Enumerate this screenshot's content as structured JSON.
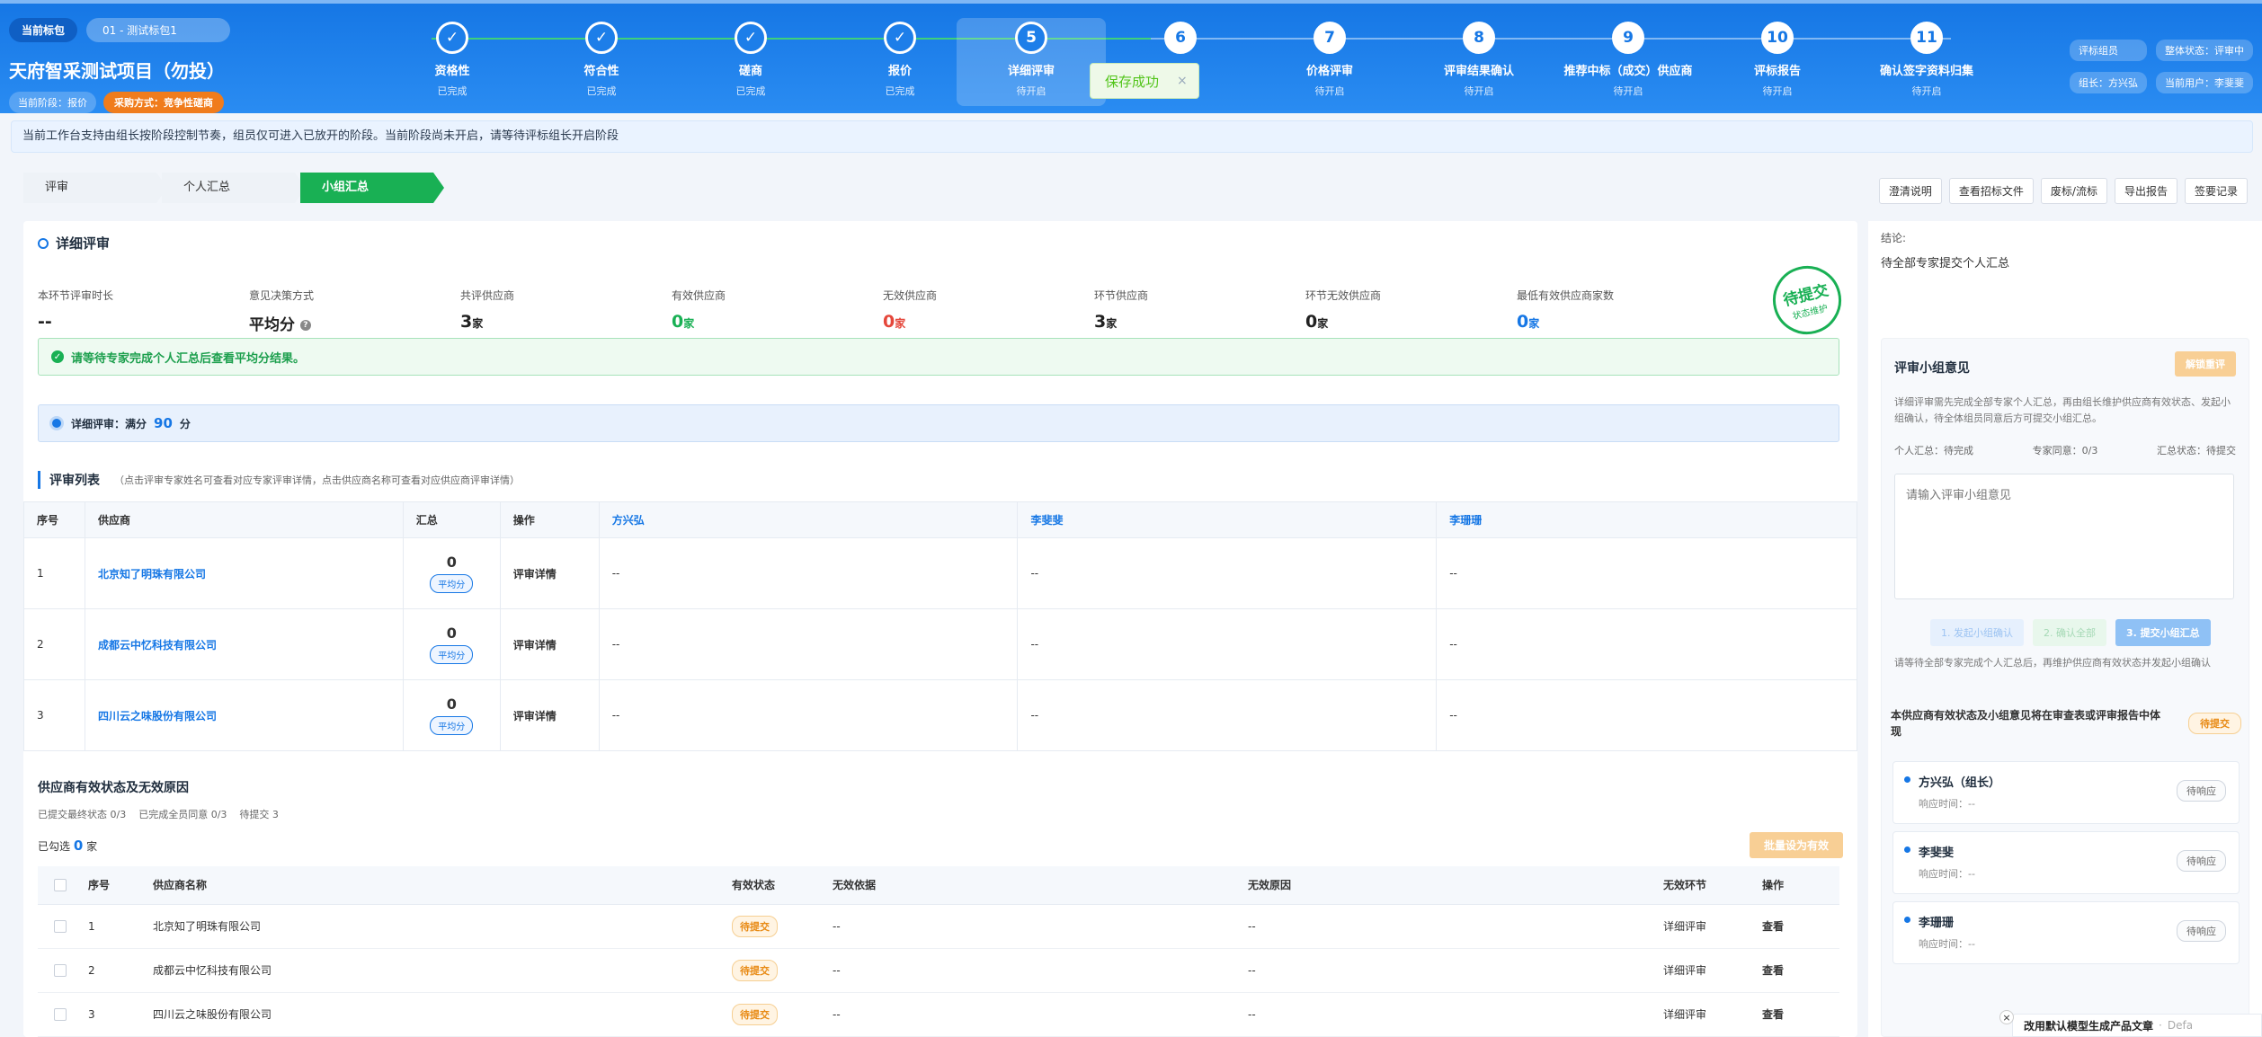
{
  "header": {
    "current_bid_label": "当前标包",
    "current_bid_value": "01 - 测试标包1",
    "project_title": "天府智采测试项目（勿投）",
    "current_stage": "当前阶段：报价",
    "procurement_method": "采购方式：竞争性磋商",
    "right_pills": [
      "评标组员",
      "整体状态：评审中",
      "组长：方兴弘",
      "当前用户：李斐斐"
    ]
  },
  "steps": [
    {
      "num": "✓",
      "name": "资格性",
      "status": "已完成",
      "state": "done"
    },
    {
      "num": "✓",
      "name": "符合性",
      "status": "已完成",
      "state": "done"
    },
    {
      "num": "✓",
      "name": "磋商",
      "status": "已完成",
      "state": "done"
    },
    {
      "num": "✓",
      "name": "报价",
      "status": "已完成",
      "state": "done"
    },
    {
      "num": "5",
      "name": "详细评审",
      "status": "待开启",
      "state": "active"
    },
    {
      "num": "6",
      "name": "",
      "status": "",
      "state": "todo"
    },
    {
      "num": "7",
      "name": "价格评审",
      "status": "待开启",
      "state": "todo"
    },
    {
      "num": "8",
      "name": "评审结果确认",
      "status": "待开启",
      "state": "todo"
    },
    {
      "num": "9",
      "name": "推荐中标（成交）供应商",
      "status": "待开启",
      "state": "todo"
    },
    {
      "num": "10",
      "name": "评标报告",
      "status": "待开启",
      "state": "todo"
    },
    {
      "num": "11",
      "name": "确认签字资料归集",
      "status": "待开启",
      "state": "todo"
    }
  ],
  "toast": {
    "text": "保存成功",
    "close": "×"
  },
  "notice": "当前工作台支持由组长按阶段控制节奏，组员仅可进入已放开的阶段。当前阶段尚未开启，请等待评标组长开启阶段",
  "tabs": [
    "评审",
    "个人汇总",
    "小组汇总"
  ],
  "top_actions": [
    "澄清说明",
    "查看招标文件",
    "废标/流标",
    "导出报告",
    "签要记录"
  ],
  "section": {
    "title": "详细评审",
    "metrics": [
      {
        "label": "本环节评审时长",
        "value": "--",
        "unit": "",
        "color": ""
      },
      {
        "label": "意见决策方式",
        "value": "平均分",
        "unit": "",
        "color": ""
      },
      {
        "label": "共评供应商",
        "value": "3",
        "unit": "家",
        "color": ""
      },
      {
        "label": "有效供应商",
        "value": "0",
        "unit": "家",
        "color": "green"
      },
      {
        "label": "无效供应商",
        "value": "0",
        "unit": "家",
        "color": "red"
      },
      {
        "label": "环节供应商",
        "value": "3",
        "unit": "家",
        "color": ""
      },
      {
        "label": "环节无效供应商",
        "value": "0",
        "unit": "家",
        "color": ""
      },
      {
        "label": "最低有效供应商家数",
        "value": "0",
        "unit": "家",
        "color": "blue"
      }
    ],
    "stamp_main": "待提交",
    "stamp_sub": "状态维护",
    "alert": "请等待专家完成个人汇总后查看平均分结果。",
    "score_prefix": "详细评审：满分",
    "score_value": "90",
    "score_unit": "分"
  },
  "list": {
    "title": "评审列表",
    "hint": "（点击评审专家姓名可查看对应专家评审详情，点击供应商名称可查看对应供应商评审详情）",
    "headers": [
      "序号",
      "供应商",
      "汇总",
      "操作",
      "方兴弘",
      "李斐斐",
      "李珊珊"
    ],
    "rows": [
      {
        "no": "1",
        "supplier": "北京知了明珠有限公司",
        "sum": "0",
        "tag": "平均分",
        "op": "评审详情",
        "e1": "--",
        "e2": "--",
        "e3": "--"
      },
      {
        "no": "2",
        "supplier": "成都云中忆科技有限公司",
        "sum": "0",
        "tag": "平均分",
        "op": "评审详情",
        "e1": "--",
        "e2": "--",
        "e3": "--"
      },
      {
        "no": "3",
        "supplier": "四川云之味股份有限公司",
        "sum": "0",
        "tag": "平均分",
        "op": "评审详情",
        "e1": "--",
        "e2": "--",
        "e3": "--"
      }
    ]
  },
  "status_section": {
    "title": "供应商有效状态及无效原因",
    "sub": [
      "已提交最终状态 0/3",
      "已完成全员同意 0/3",
      "待提交 3"
    ],
    "selected_prefix": "已勾选",
    "selected_count": "0",
    "selected_unit": "家",
    "batch_button": "批量设为有效",
    "headers": [
      "序号",
      "供应商名称",
      "有效状态",
      "无效依据",
      "无效原因",
      "无效环节",
      "操作"
    ],
    "rows": [
      {
        "no": "1",
        "name": "北京知了明珠有限公司",
        "status": "待提交",
        "basis": "--",
        "reason": "--",
        "stage": "详细评审",
        "op": "查看"
      },
      {
        "no": "2",
        "name": "成都云中忆科技有限公司",
        "status": "待提交",
        "basis": "--",
        "reason": "--",
        "stage": "详细评审",
        "op": "查看"
      },
      {
        "no": "3",
        "name": "四川云之味股份有限公司",
        "status": "待提交",
        "basis": "--",
        "reason": "--",
        "stage": "详细评审",
        "op": "查看"
      }
    ]
  },
  "right_panel": {
    "conclusion_label": "结论:",
    "conclusion_text": "待全部专家提交个人汇总",
    "group_title": "评审小组意见",
    "unlock_button": "解锁重评",
    "desc": "详细评审需先完成全部专家个人汇总，再由组长维护供应商有效状态、发起小组确认，待全体组员同意后方可提交小组汇总。",
    "stat_personal": "个人汇总：待完成",
    "stat_agree": "专家同意：0/3",
    "stat_summary": "汇总状态：待提交",
    "textarea_placeholder": "请输入评审小组意见",
    "step1": "1. 发起小组确认",
    "step2": "2. 确认全部",
    "step3": "3. 提交小组汇总",
    "note": "请等待全部专家完成个人汇总后，再维护供应商有效状态并发起小组确认",
    "report_text": "本供应商有效状态及小组意见将在审查表或评审报告中体现",
    "report_tag": "待提交",
    "members": [
      {
        "name": "方兴弘（组长）",
        "time": "响应时间：--",
        "status": "待响应"
      },
      {
        "name": "李斐斐",
        "time": "响应时间：--",
        "status": "待响应"
      },
      {
        "name": "李珊珊",
        "time": "响应时间：--",
        "status": "待响应"
      }
    ]
  },
  "bottom_note": {
    "text": "改用默认模型生成产品文章",
    "dot": "·",
    "suffix": "Defa",
    "close": "×"
  },
  "colors": {
    "primary": "#1677e5",
    "success": "#19b054",
    "danger": "#e5473b",
    "warning": "#e88a14"
  }
}
